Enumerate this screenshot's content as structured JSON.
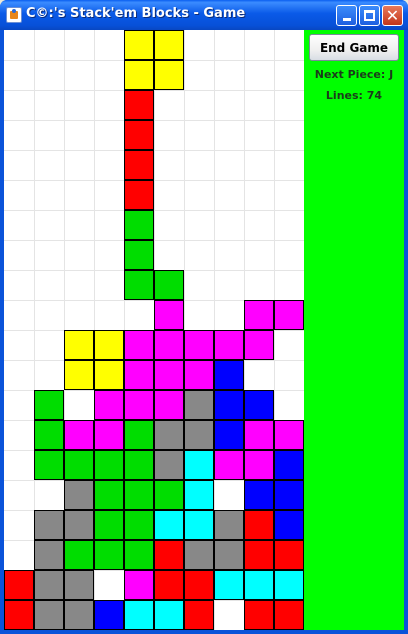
{
  "window": {
    "title": "C©:'s Stack'em Blocks - Game"
  },
  "side_panel": {
    "end_game_label": "End Game",
    "next_piece_text": "Next Piece: J",
    "lines_text": "Lines: 74",
    "background_color": "#00FF00"
  },
  "board": {
    "columns": 10,
    "rows": 20,
    "colors": {
      "Y": "#FFFF00",
      "R": "#FF0000",
      "G": "#00DD00",
      "M": "#FF00FF",
      "B": "#0000FF",
      "C": "#00FFFF",
      "D": "#888888"
    },
    "grid": [
      "....YY....",
      "....YY....",
      "....R.....",
      "....R.....",
      "....R.....",
      "....R.....",
      "....G.....",
      "....G.....",
      "....GG....",
      ".....M..MM",
      "..YYMMMMM.",
      "..YYMMMB..",
      ".G.MMMDBB.",
      ".GMMGDDBMM",
      ".GGGGDCMMB",
      "..DGGGC.BB",
      ".DDGGCCDRB",
      ".DGGGRDDRR",
      "RDD.MRRCCC",
      "RDDBCCR.RR"
    ]
  }
}
